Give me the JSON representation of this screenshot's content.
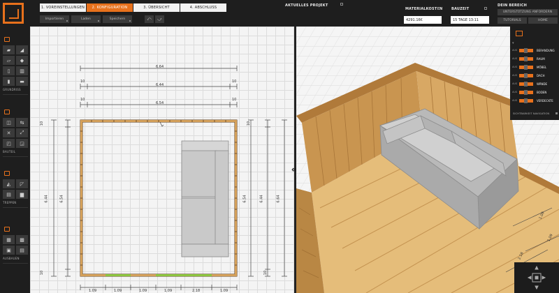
{
  "topbar": {
    "steps": [
      "1. VOREINSTELLUNGEN",
      "2. KONFIGURATION",
      "3. ÜBERSICHT",
      "4. ABSCHLUSS"
    ],
    "sub_buttons": [
      "Importieren",
      "Laden",
      "Speichern"
    ],
    "current_project_label": "AKTUELLES PROJEKT",
    "material_cost_label": "MATERIALKOSTEN",
    "material_cost_value": "4291.16€",
    "build_time_label": "BAUZEIT",
    "build_time_value": "15 TAGE 13:11",
    "area_label": "DEIN BEREICH",
    "support_button": "UNTERSTÜTZUNG ANFORDERN",
    "tutorials_button": "TUTORIALS",
    "home_button": "HOME"
  },
  "left_toolbar": {
    "groups": [
      {
        "label": "GRUNDRISS"
      },
      {
        "label": "BAUTEIL"
      },
      {
        "label": "TREPPEN"
      },
      {
        "label": "AUSBAUEN"
      }
    ]
  },
  "plan": {
    "dims_top": [
      "6.64",
      "10",
      "10",
      "6.44",
      "10",
      "10",
      "6.54"
    ],
    "dims_left": [
      "10",
      "6.44",
      "6.54",
      "10"
    ],
    "dims_right": [
      "10",
      "6.54",
      "6.44",
      "6.64",
      "10"
    ],
    "dims_bottom": [
      "1.09",
      "1.09",
      "1.09",
      "1.09",
      "2.18",
      "1.09"
    ]
  },
  "view3d": {
    "dims": [
      "1.09",
      "1.09",
      "2.18"
    ]
  },
  "right_panel": {
    "toggles": [
      "BERANDUNG",
      "RAUM",
      "MÖBEL",
      "DACH",
      "WÄNDE",
      "BODEN",
      "VERDECKTE"
    ],
    "off_label": "AUS",
    "nav_label": "SICHTBARKEIT NAVIGATION"
  },
  "colors": {
    "accent": "#e8711c",
    "wood": "#d4a05a",
    "floor": "#e5bd7a",
    "sofa": "#a8a8a8",
    "green_section": "#8dc63f"
  }
}
